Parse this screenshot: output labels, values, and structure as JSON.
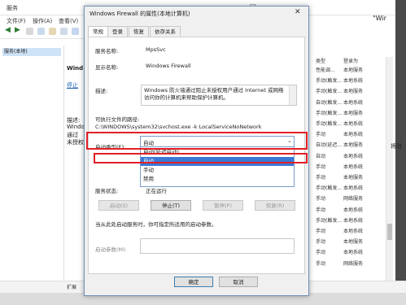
{
  "background": {
    "window_title": "服务",
    "menu": [
      "文件(F)",
      "操作(A)",
      "查看(V)"
    ],
    "tree_item": "服务(本地)",
    "desc_panel": {
      "head": "Wind",
      "line1": "停止",
      "line2": "描述:",
      "line3": "Windo",
      "line4": "通过",
      "line5": "未授权"
    },
    "columns": [
      "类型",
      "登录为"
    ],
    "rows": [
      [
        "性能调...",
        "本地服务"
      ],
      [
        "手动(触发...",
        "本地系统"
      ],
      [
        "手动(触发...",
        "本地服务"
      ],
      [
        "自动(触发...",
        "本地系统"
      ],
      [
        "手动(触发...",
        "本地服务"
      ],
      [
        "手动(触发...",
        "本地系统"
      ],
      [
        "手动",
        "本地系统"
      ],
      [
        "自动(延迟...",
        "本地服务"
      ],
      [
        "自动",
        "本地系统"
      ],
      [
        "手动",
        "本地系统"
      ],
      [
        "手动",
        "本地服务"
      ],
      [
        "手动(触发...",
        "本地系统"
      ],
      [
        "手动",
        "网络服务"
      ],
      [
        "手动",
        "本地系统"
      ],
      [
        "手动(触发...",
        "本地系统"
      ],
      [
        "手动",
        "本地系统"
      ],
      [
        "手动",
        "本地服务"
      ],
      [
        "手动",
        "本地系统"
      ],
      [
        "手动",
        "网络服务"
      ]
    ],
    "status_tab": "扩展",
    "external_snippet_1": "\"Wir",
    "external_snippet_2": "将驳"
  },
  "dialog": {
    "title": "Windows Firewall 的属性(本地计算机)",
    "tabs": [
      "常规",
      "登录",
      "恢复",
      "依存关系"
    ],
    "active_tab": "常规",
    "service_name_label": "服务名称:",
    "service_name_value": "MpsSvc",
    "display_name_label": "显示名称:",
    "display_name_value": "Windows Firewall",
    "description_label": "描述:",
    "description_value": "Windows 防火墙通过阻止未授权用户通过 Internet 或网络访问你的计算机来帮助保护计算机。",
    "exe_path_label": "可执行文件的路径:",
    "exe_path_value": "C:\\WINDOWS\\system32\\svchost.exe -k LocalServiceNoNetwork",
    "startup_type_label": "启动类型(E):",
    "startup_type_value": "自动",
    "startup_options": [
      "自动(延迟启动)",
      "自动",
      "手动",
      "禁用"
    ],
    "startup_selected_index": 1,
    "service_status_label": "服务状态:",
    "service_status_value": "正在运行",
    "buttons": {
      "start": "启动(S)",
      "stop": "停止(T)",
      "pause": "暂停(P)",
      "resume": "恢复(R)"
    },
    "hint": "当从此处启动服务时，你可指定所适用的启动参数。",
    "param_label": "启动参数(M):",
    "param_value": "",
    "ok": "确定",
    "cancel": "取消",
    "highlight_color": "#e21f26",
    "selection_color": "#3a78d6"
  }
}
